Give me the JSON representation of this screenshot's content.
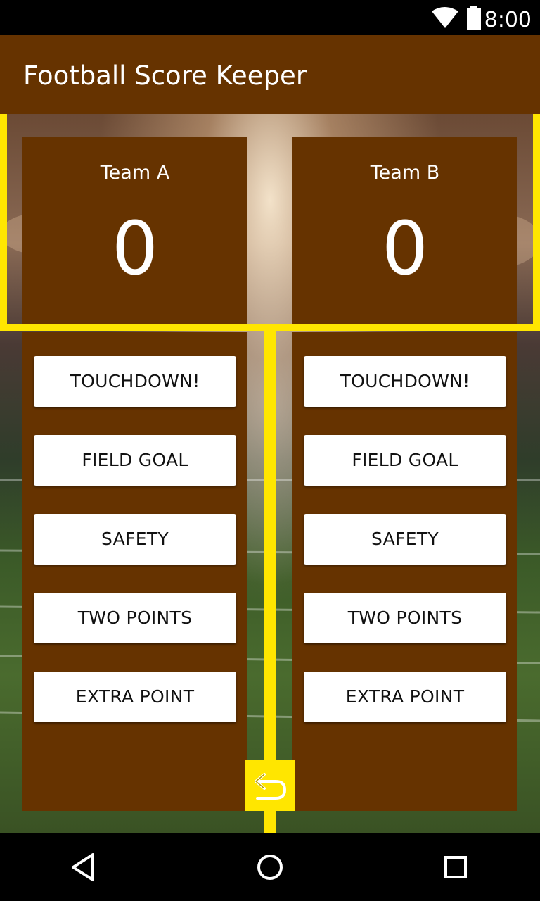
{
  "status_bar": {
    "time": "8:00",
    "icons": [
      "wifi-icon",
      "battery-icon"
    ]
  },
  "app_bar": {
    "title": "Football Score Keeper",
    "color": "#663300"
  },
  "theme": {
    "accent": "#ffe600",
    "panel": "#663300"
  },
  "teams": [
    {
      "name": "Team A",
      "score": "0",
      "buttons": [
        "TOUCHDOWN!",
        "FIELD GOAL",
        "SAFETY",
        "TWO POINTS",
        "EXTRA POINT"
      ]
    },
    {
      "name": "Team B",
      "score": "0",
      "buttons": [
        "TOUCHDOWN!",
        "FIELD GOAL",
        "SAFETY",
        "TWO POINTS",
        "EXTRA POINT"
      ]
    }
  ],
  "undo": {
    "icon": "undo-icon"
  },
  "nav_bar": {
    "icons": [
      "back-icon",
      "home-icon",
      "recents-icon"
    ]
  }
}
